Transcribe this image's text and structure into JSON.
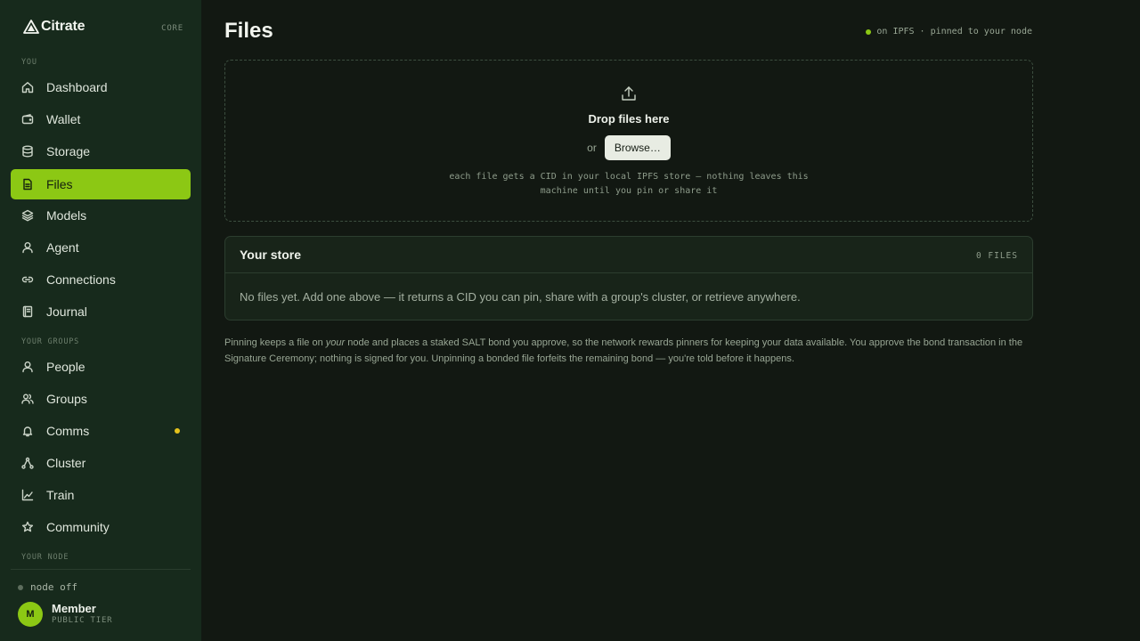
{
  "sidebar": {
    "brand": "Citrate",
    "tier_tag": "CORE",
    "sections": {
      "you": "YOU",
      "groups": "YOUR GROUPS",
      "node": "YOUR NODE"
    },
    "items": [
      {
        "label": "Dashboard",
        "icon": "home-icon"
      },
      {
        "label": "Wallet",
        "icon": "wallet-icon"
      },
      {
        "label": "Storage",
        "icon": "database-icon"
      },
      {
        "label": "Files",
        "icon": "file-icon",
        "active": true
      },
      {
        "label": "Models",
        "icon": "layers-icon"
      },
      {
        "label": "Agent",
        "icon": "user-icon"
      },
      {
        "label": "Connections",
        "icon": "link-icon"
      },
      {
        "label": "Journal",
        "icon": "journal-icon"
      },
      {
        "label": "People",
        "icon": "person-icon"
      },
      {
        "label": "Groups",
        "icon": "users-icon"
      },
      {
        "label": "Comms",
        "icon": "bell-icon",
        "has_notification": true
      },
      {
        "label": "Cluster",
        "icon": "cluster-icon"
      },
      {
        "label": "Train",
        "icon": "chart-icon"
      },
      {
        "label": "Community",
        "icon": "star-icon"
      }
    ],
    "node_status": "node off",
    "user": {
      "initial": "M",
      "name": "Member",
      "tier": "PUBLIC TIER"
    }
  },
  "main": {
    "title": "Files",
    "ipfs_status": "on IPFS · pinned to your node",
    "dropzone": {
      "title": "Drop files here",
      "or": "or",
      "browse": "Browse…",
      "note_line1": "each file gets a CID in your local IPFS store — nothing leaves this",
      "note_line2": "machine until you pin or share it"
    },
    "store": {
      "title": "Your store",
      "count": "0 FILES",
      "empty": "No files yet. Add one above — it returns a CID you can pin, share with a group's cluster, or retrieve anywhere."
    },
    "footer": {
      "part1": "Pinning keeps a file on ",
      "emph": "your",
      "part2": " node and places a staked SALT bond you approve, so the network rewards pinners for keeping your data available. You approve the bond transaction in the Signature Ceremony; nothing is signed for you. Unpinning a bonded file forfeits the remaining bond — you're told before it happens."
    }
  },
  "colors": {
    "accent": "#8cc814",
    "notification": "#e5c21c",
    "sidebar_bg": "#172a1c",
    "page_bg": "#121812"
  }
}
